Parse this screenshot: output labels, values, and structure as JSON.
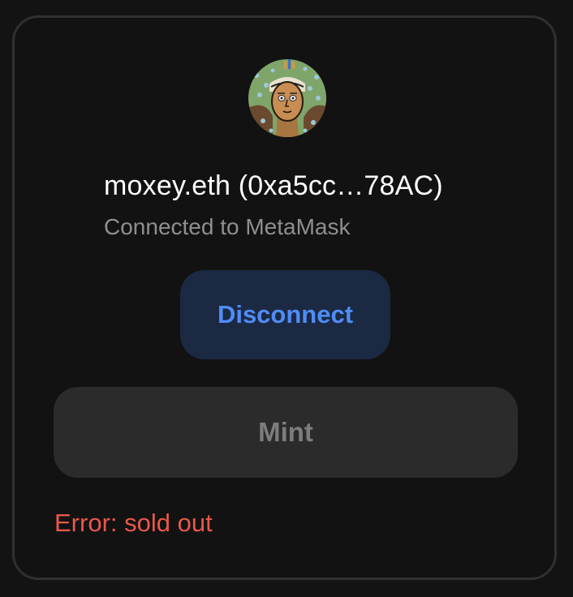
{
  "wallet": {
    "avatar_icon": "nft-avatar-portrait",
    "account_label": "moxey.eth (0xa5cc…78AC)",
    "connector_status": "Connected to MetaMask"
  },
  "actions": {
    "disconnect_label": "Disconnect",
    "mint_label": "Mint",
    "mint_disabled": true
  },
  "status": {
    "error_message": "Error: sold out"
  },
  "colors": {
    "background": "#121212",
    "card_border": "#303030",
    "disconnect_bg": "#1b2942",
    "disconnect_text": "#4f8cf6",
    "mint_bg": "#2b2b2b",
    "mint_text": "#7d7d7d",
    "error": "#e9574b"
  }
}
